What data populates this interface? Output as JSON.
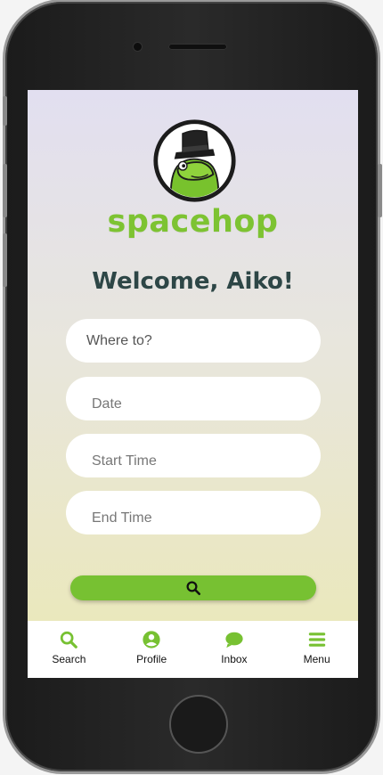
{
  "app": {
    "brand": "spacehop",
    "welcome": "Welcome, Aiko!"
  },
  "form": {
    "destination_placeholder": "Where to?",
    "date_placeholder": "Date",
    "start_time_placeholder": "Start Time",
    "end_time_placeholder": "End Time",
    "search_icon": "search-icon"
  },
  "nav": {
    "items": [
      {
        "label": "Search",
        "icon": "search-icon"
      },
      {
        "label": "Profile",
        "icon": "user-icon"
      },
      {
        "label": "Inbox",
        "icon": "chat-icon"
      },
      {
        "label": "Menu",
        "icon": "menu-icon"
      }
    ]
  },
  "colors": {
    "brand_green": "#7dc332",
    "welcome_text": "#2d4646",
    "button_green": "#77c132"
  }
}
